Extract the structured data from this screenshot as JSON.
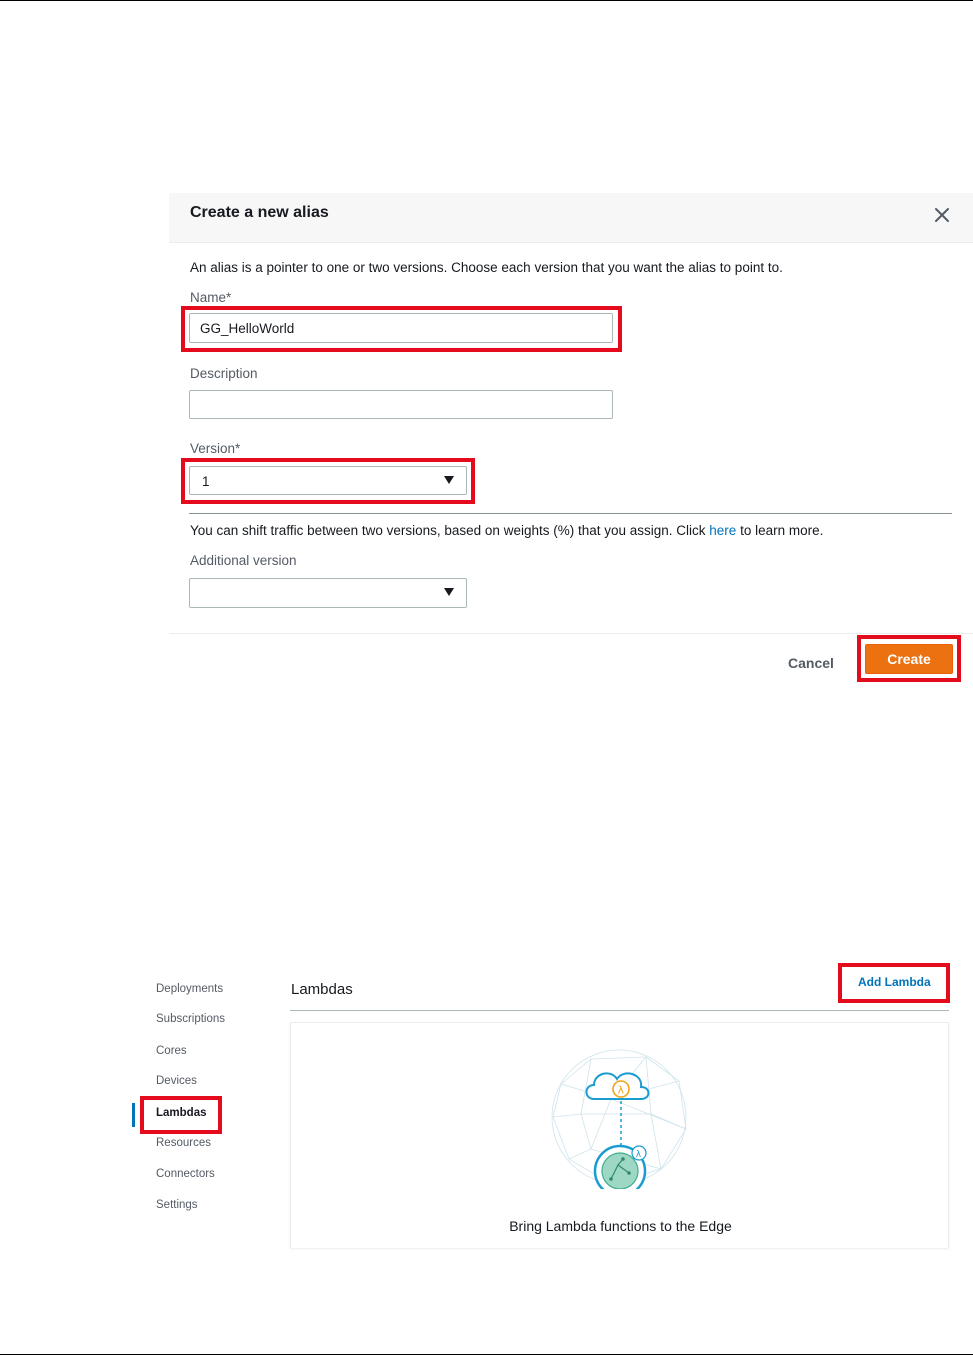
{
  "dialog": {
    "title": "Create a new alias",
    "intro": "An alias is a pointer to one or two versions. Choose each version that you want the alias to point to.",
    "name_label": "Name*",
    "name_value": "GG_HelloWorld",
    "description_label": "Description",
    "description_value": "",
    "version_label": "Version*",
    "version_value": "1",
    "shift_text_before": "You can shift traffic between two versions, based on weights (%) that you assign. Click ",
    "shift_link": "here",
    "shift_text_after": " to learn more.",
    "additional_version_label": "Additional version",
    "additional_version_value": "",
    "cancel_label": "Cancel",
    "create_label": "Create"
  },
  "sidebar": {
    "items": [
      {
        "label": "Deployments"
      },
      {
        "label": "Subscriptions"
      },
      {
        "label": "Cores"
      },
      {
        "label": "Devices"
      },
      {
        "label": "Lambdas",
        "active": true
      },
      {
        "label": "Resources"
      },
      {
        "label": "Connectors"
      },
      {
        "label": "Settings"
      }
    ]
  },
  "lambdas": {
    "title": "Lambdas",
    "add_button": "Add Lambda",
    "empty_caption": "Bring Lambda functions to the Edge"
  },
  "colors": {
    "primary_button": "#ec7211",
    "link": "#0073bb",
    "highlight": "#e30b1c"
  },
  "icons": [
    "close-icon",
    "dropdown-caret-icon",
    "lambda-cloud-icon",
    "lambda-edge-device-icon"
  ]
}
